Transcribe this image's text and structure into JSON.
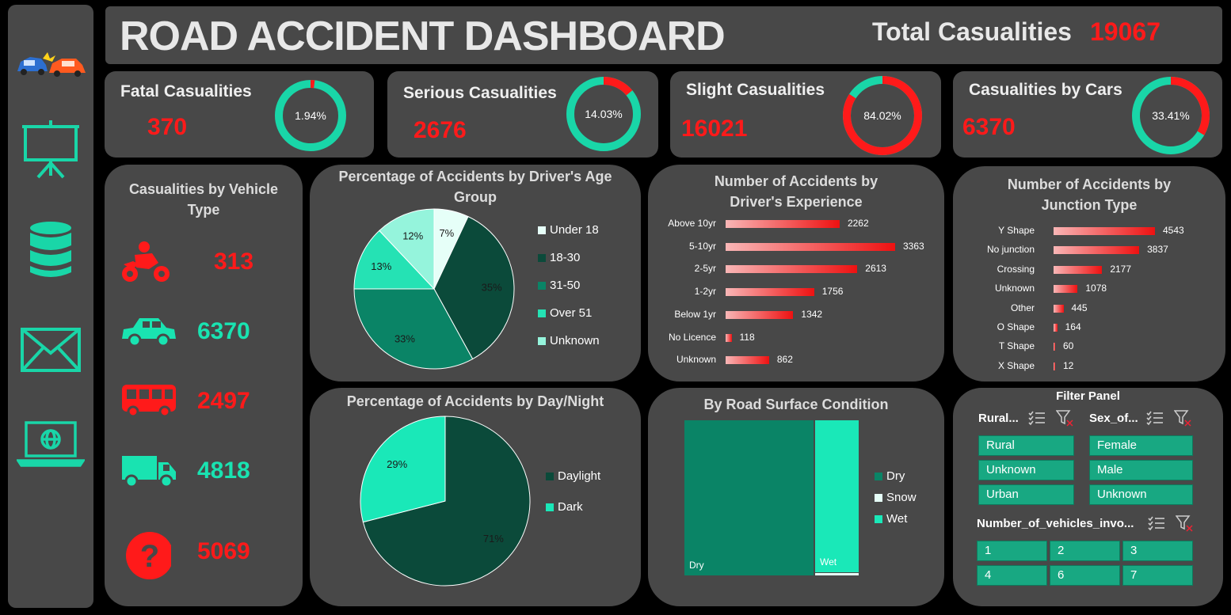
{
  "header": {
    "title": "ROAD ACCIDENT DASHBOARD",
    "total_label": "Total Casualities",
    "total_value": "19067"
  },
  "sidebar": {
    "icons": [
      "car-crash-icon",
      "presentation-icon",
      "database-icon",
      "mail-icon",
      "laptop-globe-icon"
    ]
  },
  "kpis": [
    {
      "label": "Fatal Casualities",
      "value": "370",
      "percent": "1.94%",
      "fraction": 0.0194
    },
    {
      "label": "Serious Casualities",
      "value": "2676",
      "percent": "14.03%",
      "fraction": 0.1403
    },
    {
      "label": "Slight Casualities",
      "value": "16021",
      "percent": "84.02%",
      "fraction": 0.8402
    },
    {
      "label": "Casualities by Cars",
      "value": "6370",
      "percent": "33.41%",
      "fraction": 0.3341
    }
  ],
  "vehicle": {
    "title": "Casualities by Vehicle Type",
    "rows": [
      {
        "icon": "motorbike-icon",
        "value": "313",
        "color": "#ff1a1a"
      },
      {
        "icon": "car-icon",
        "value": "6370",
        "color": "#19e3b1"
      },
      {
        "icon": "bus-icon",
        "value": "2497",
        "color": "#ff1a1a"
      },
      {
        "icon": "truck-icon",
        "value": "4818",
        "color": "#19e3b1"
      },
      {
        "icon": "question-icon",
        "value": "5069",
        "color": "#ff1a1a"
      }
    ]
  },
  "colors": {
    "teal": "#19e3b1",
    "red": "#ff1a1a",
    "panel": "#484848",
    "dark_green": "#0b4a3a"
  },
  "chart_data": [
    {
      "type": "pie",
      "title": "Percentage of Accidents by Driver's Age Group",
      "categories": [
        "Under 18",
        "18-30",
        "31-50",
        "Over 51",
        "Unknown"
      ],
      "values": [
        7,
        35,
        33,
        13,
        12
      ],
      "labels": [
        "7%",
        "35%",
        "33%",
        "13%",
        "12%"
      ],
      "colors": [
        "#e6fff8",
        "#0b4a3a",
        "#0a8466",
        "#25e2b4",
        "#95f4dc"
      ],
      "legend": "right"
    },
    {
      "type": "bar",
      "orientation": "horizontal",
      "title": "Number of Accidents by Driver's Experience",
      "categories": [
        "Above 10yr",
        "5-10yr",
        "2-5yr",
        "1-2yr",
        "Below 1yr",
        "No Licence",
        "Unknown"
      ],
      "values": [
        2262,
        3363,
        2613,
        1756,
        1342,
        118,
        862
      ]
    },
    {
      "type": "bar",
      "orientation": "horizontal",
      "title": "Number of Accidents by Junction Type",
      "categories": [
        "Y Shape",
        "No junction",
        "Crossing",
        "Unknown",
        "Other",
        "O Shape",
        "T Shape",
        "X Shape"
      ],
      "values": [
        4543,
        3837,
        2177,
        1078,
        445,
        164,
        60,
        12
      ]
    },
    {
      "type": "pie",
      "title": "Percentage of Accidents by Day/Night",
      "categories": [
        "Daylight",
        "Dark"
      ],
      "values": [
        71,
        29
      ],
      "labels": [
        "71%",
        "29%"
      ],
      "colors": [
        "#0b4a3a",
        "#1ae8b8"
      ],
      "legend": "right"
    },
    {
      "type": "treemap",
      "title": "By Road Surface Condition",
      "categories": [
        "Dry",
        "Snow",
        "Wet"
      ],
      "values": [
        75,
        1,
        24
      ],
      "colors": [
        "#0a8466",
        "#e6fff8",
        "#1ae8b8"
      ],
      "legend": "right"
    }
  ],
  "filter_panel": {
    "title": "Filter Panel",
    "rural": {
      "header": "Rural...",
      "options": [
        "Rural",
        "Unknown",
        "Urban"
      ]
    },
    "sex": {
      "header": "Sex_of...",
      "options": [
        "Female",
        "Male",
        "Unknown"
      ]
    },
    "vehicles": {
      "header": "Number_of_vehicles_invo...",
      "options": [
        "1",
        "2",
        "3",
        "4",
        "6",
        "7"
      ]
    }
  }
}
